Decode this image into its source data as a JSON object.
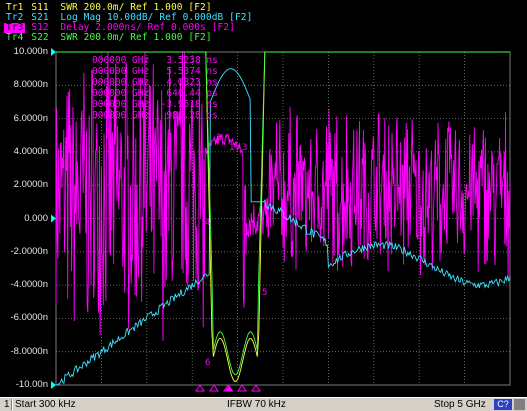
{
  "traces": [
    {
      "id": "Tr1",
      "text": " S11  SWR 200.0m/ Ref 1.000 [F2]",
      "color": "#ffff40",
      "active": false
    },
    {
      "id": "Tr2",
      "text": " S21  Log Mag 10.00dB/ Ref 0.000dB [F2]",
      "color": "#40e0ff",
      "active": false
    },
    {
      "id": "Tr3",
      "text": " S12  Delay 2.000ns/ Ref 0.000s [F2]",
      "color": "#ff00ff",
      "active": true
    },
    {
      "id": "Tr4",
      "text": " S22  SWR 200.0m/ Ref 1.000 [F2]",
      "color": "#40ff40",
      "active": false
    }
  ],
  "y_axis": {
    "labels": [
      "10.000n",
      "8.0000n",
      "6.0000n",
      "4.0000n",
      "2.0000n",
      "0.000",
      "-2.0000n",
      "-4.0000n",
      "-6.0000n",
      "-8.0000n",
      "-10.00n"
    ],
    "min": -10,
    "max": 10,
    "unit": "ns"
  },
  "marker_table": [
    {
      "freq": "000000 GHz",
      "value": " 3.5238 ns"
    },
    {
      "freq": "000000 GHz",
      "value": " 5.5374 ns"
    },
    {
      "freq": "000000 GHz",
      "value": " 4.0823 ns"
    },
    {
      "freq": "000000 GHz",
      "value": " 646.44 ps"
    },
    {
      "freq": "000000 GHz",
      "value": "-3.9618 ns"
    },
    {
      "freq": "000000 GHz",
      "value": " 986.28 ps"
    }
  ],
  "marker_numbers": [
    "1",
    "2",
    "3",
    "4",
    "5",
    "6"
  ],
  "statusbar": {
    "channel": "1",
    "start": "Start 300 kHz",
    "ifbw": "IFBW 70 kHz",
    "stop": "Stop 5 GHz",
    "badge": "C?"
  },
  "colors": {
    "grid": "#7a7a7a",
    "s12": "#ff00ff",
    "s21": "#40e0ff",
    "s11": "#ffff40",
    "s22": "#40ff40",
    "ref_marker": "#00ffff"
  }
}
